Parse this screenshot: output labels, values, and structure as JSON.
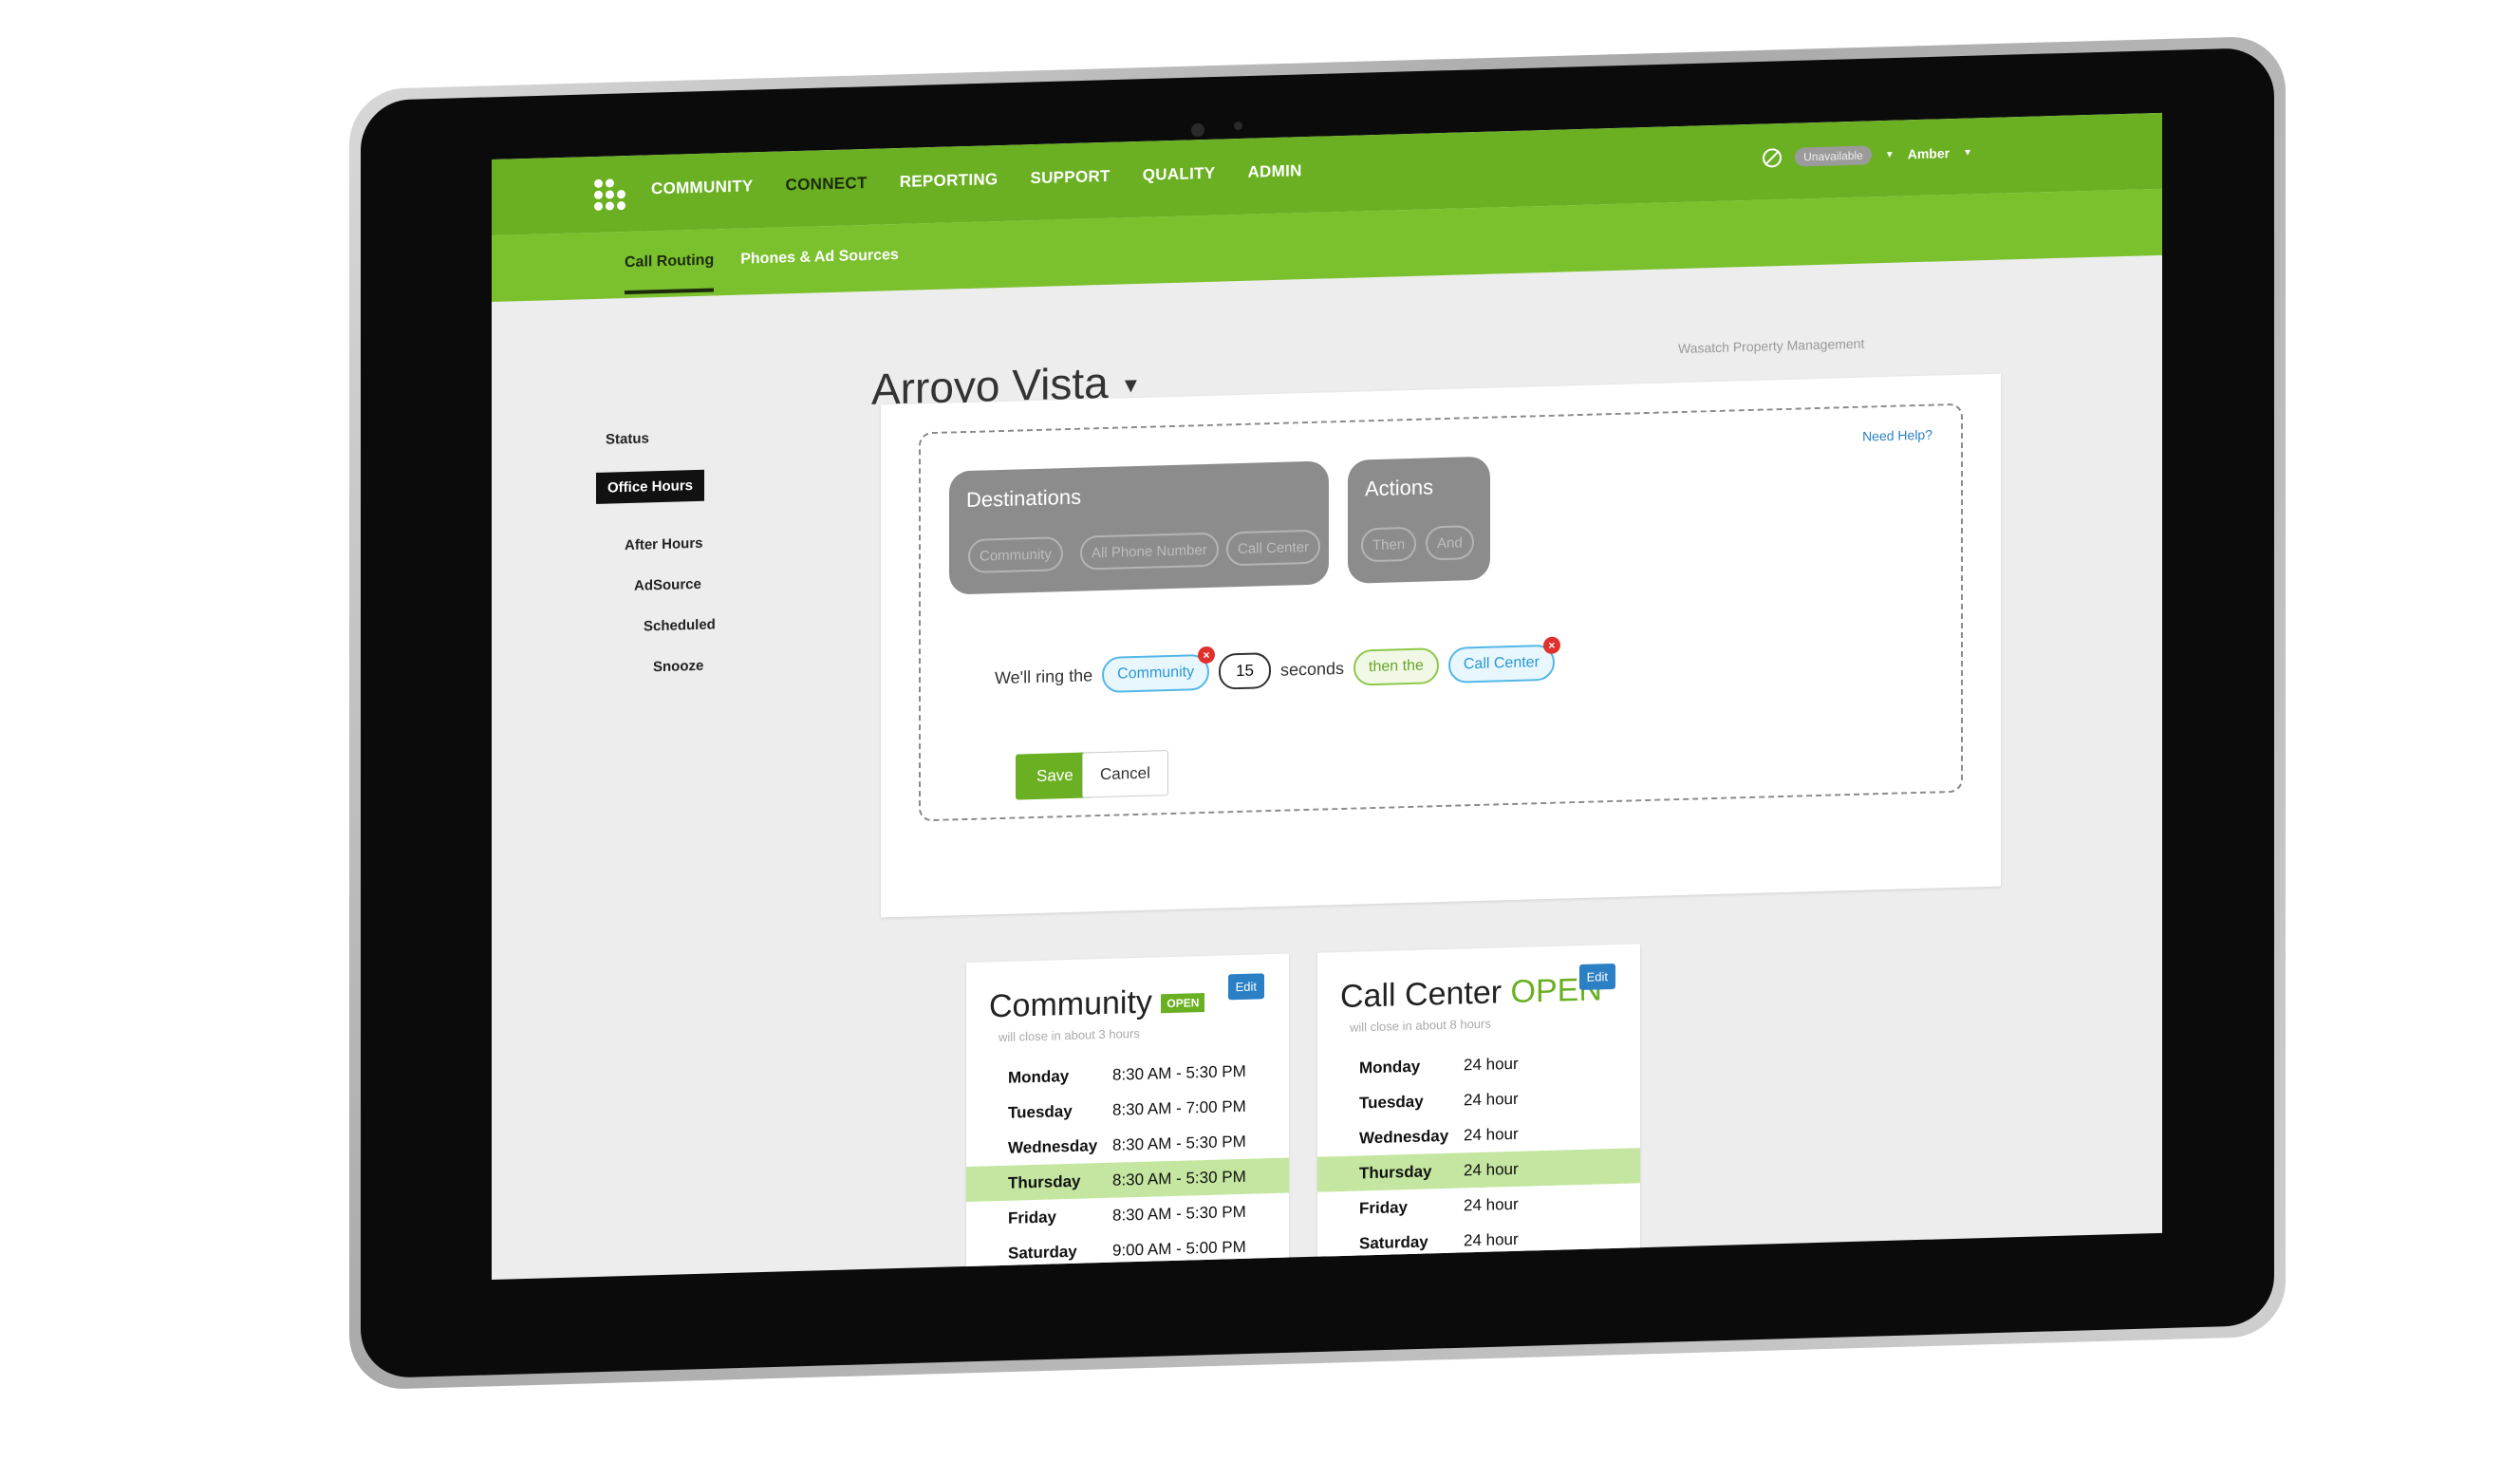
{
  "nav": {
    "items": [
      "COMMUNITY",
      "CONNECT",
      "REPORTING",
      "SUPPORT",
      "QUALITY",
      "ADMIN"
    ],
    "active": "CONNECT"
  },
  "user": {
    "status": "Unavailable",
    "name": "Amber"
  },
  "subnav": {
    "items": [
      "Call Routing",
      "Phones & Ad Sources"
    ],
    "active": "Call Routing"
  },
  "sidebar": {
    "items": [
      "Status",
      "Office Hours",
      "After Hours",
      "AdSource",
      "Scheduled",
      "Snooze"
    ],
    "active": "Office Hours"
  },
  "page": {
    "title": "Arroyo Vista",
    "company": "Wasatch Property Management"
  },
  "builder": {
    "help": "Need Help?",
    "destinations": {
      "title": "Destinations",
      "chips": [
        "Community",
        "All Phone Number",
        "Call Center"
      ]
    },
    "actions": {
      "title": "Actions",
      "chips": [
        "Then",
        "And"
      ]
    },
    "rule": {
      "prefix": "We'll ring the",
      "target": "Community",
      "seconds_value": "15",
      "seconds_label": "seconds",
      "connector": "then the",
      "next_target": "Call Center"
    },
    "save": "Save",
    "cancel": "Cancel"
  },
  "cards": [
    {
      "title": "Community",
      "status": "OPEN",
      "subtitle": "will close in about 3 hours",
      "edit": "Edit",
      "rows": [
        {
          "day": "Monday",
          "hours": "8:30 AM - 5:30 PM"
        },
        {
          "day": "Tuesday",
          "hours": "8:30 AM - 7:00 PM"
        },
        {
          "day": "Wednesday",
          "hours": "8:30 AM - 5:30 PM"
        },
        {
          "day": "Thursday",
          "hours": "8:30 AM - 5:30 PM"
        },
        {
          "day": "Friday",
          "hours": "8:30 AM - 5:30 PM"
        },
        {
          "day": "Saturday",
          "hours": "9:00 AM - 5:00 PM"
        }
      ],
      "today": "Thursday"
    },
    {
      "title": "Call Center",
      "status": "OPEN",
      "subtitle": "will close in about 8 hours",
      "edit": "Edit",
      "rows": [
        {
          "day": "Monday",
          "hours": "24 hour"
        },
        {
          "day": "Tuesday",
          "hours": "24 hour"
        },
        {
          "day": "Wednesday",
          "hours": "24 hour"
        },
        {
          "day": "Thursday",
          "hours": "24 hour"
        },
        {
          "day": "Friday",
          "hours": "24 hour"
        },
        {
          "day": "Saturday",
          "hours": "24 hour"
        }
      ],
      "today": "Thursday"
    }
  ],
  "colors": {
    "brand_green": "#6ab022",
    "accent_blue": "#2a7fc5",
    "remove_red": "#e0322c"
  }
}
